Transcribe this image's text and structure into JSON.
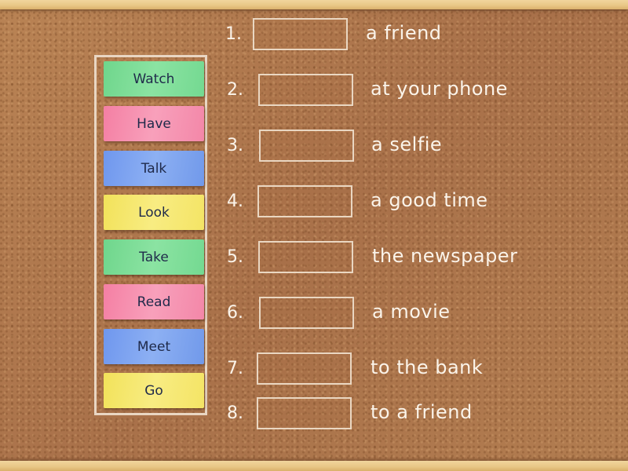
{
  "activity": {
    "type": "match-up",
    "word_bank": [
      {
        "label": "Watch",
        "color": "green"
      },
      {
        "label": "Have",
        "color": "pink"
      },
      {
        "label": "Talk",
        "color": "blue"
      },
      {
        "label": "Look",
        "color": "yellow"
      },
      {
        "label": "Take",
        "color": "green"
      },
      {
        "label": "Read",
        "color": "pink"
      },
      {
        "label": "Meet",
        "color": "blue"
      },
      {
        "label": "Go",
        "color": "yellow"
      }
    ],
    "items": [
      {
        "number": "1.",
        "answer": "",
        "phrase": "a friend"
      },
      {
        "number": "2.",
        "answer": "",
        "phrase": "at your phone"
      },
      {
        "number": "3.",
        "answer": "",
        "phrase": "a selfie"
      },
      {
        "number": "4.",
        "answer": "",
        "phrase": "a good time"
      },
      {
        "number": "5.",
        "answer": "",
        "phrase": "the newspaper"
      },
      {
        "number": "6.",
        "answer": "",
        "phrase": "a movie"
      },
      {
        "number": "7.",
        "answer": "",
        "phrase": "to the bank"
      },
      {
        "number": "8.",
        "answer": "",
        "phrase": "to a friend"
      }
    ]
  },
  "colors": {
    "green": "#7bdc96",
    "pink": "#f690b0",
    "blue": "#7ea3ef",
    "yellow": "#f5e66f",
    "cork": "#b27a4c",
    "chalk": "#fbf4ea"
  }
}
